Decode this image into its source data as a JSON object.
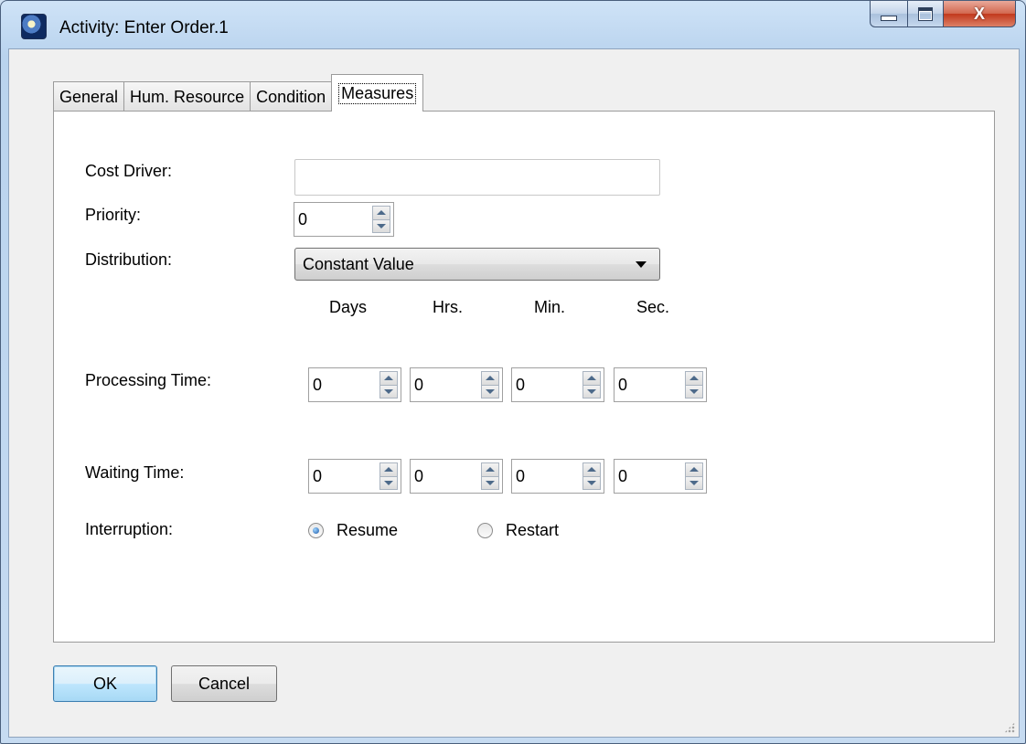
{
  "window": {
    "title": "Activity: Enter Order.1",
    "icon": "app-icon",
    "caption_icons": [
      "minimize-icon",
      "maximize-icon",
      "close-icon"
    ],
    "close_glyph": "X"
  },
  "tabs": [
    {
      "label": "General",
      "selected": false
    },
    {
      "label": "Hum. Resource",
      "selected": false
    },
    {
      "label": "Condition",
      "selected": false
    },
    {
      "label": "Measures",
      "selected": true
    }
  ],
  "form": {
    "cost_driver": {
      "label": "Cost Driver:",
      "value": ""
    },
    "priority": {
      "label": "Priority:",
      "value": "0"
    },
    "distribution": {
      "label": "Distribution:",
      "value": "Constant Value"
    },
    "time_headers": [
      "Days",
      "Hrs.",
      "Min.",
      "Sec."
    ],
    "processing_time": {
      "label": "Processing Time:",
      "values": [
        "0",
        "0",
        "0",
        "0"
      ]
    },
    "waiting_time": {
      "label": "Waiting Time:",
      "values": [
        "0",
        "0",
        "0",
        "0"
      ]
    },
    "interruption": {
      "label": "Interruption:",
      "options": [
        {
          "label": "Resume",
          "selected": true
        },
        {
          "label": "Restart",
          "selected": false
        }
      ]
    }
  },
  "buttons": {
    "ok": "OK",
    "cancel": "Cancel"
  },
  "colors": {
    "accent": "#3c7fb1",
    "title_bar": "#b9d3ee",
    "close_button": "#c2381c"
  }
}
